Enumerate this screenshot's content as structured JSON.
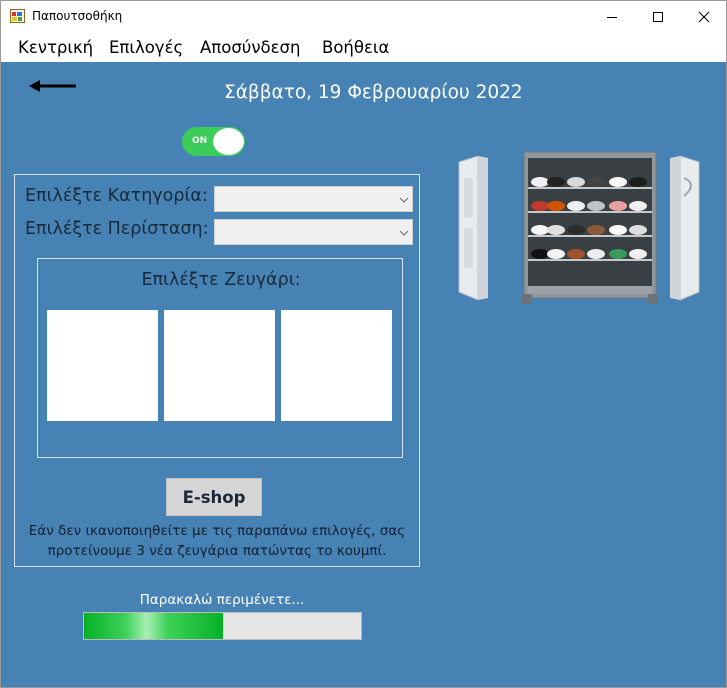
{
  "window": {
    "title": "Παπουτσοθήκη"
  },
  "menu": {
    "items": [
      {
        "label": "Κεντρική"
      },
      {
        "label": "Επιλογές"
      },
      {
        "label": "Αποσύνδεση"
      },
      {
        "label": "Βοήθεια"
      }
    ]
  },
  "header": {
    "date": "Σάββατο, 19 Φεβρουαρίου 2022",
    "back_icon": "left-arrow-icon"
  },
  "toggle": {
    "label": "ON",
    "state": "on",
    "color": "#3bcc5a"
  },
  "form": {
    "category_label": "Επιλέξτε Κατηγορία:",
    "category_value": "",
    "occasion_label": "Επιλέξτε Περίσταση:",
    "occasion_value": ""
  },
  "pairs": {
    "title": "Επιλέξτε Ζευγάρι:"
  },
  "eshop": {
    "button_label": "E-shop",
    "hint_line1": "Εάν δεν ικανοποιηθείτε με τις παραπάνω επιλογές, σας",
    "hint_line2": "προτείνουμε 3 νέα ζευγάρια πατώντας το κουμπί."
  },
  "status": {
    "wait_label": "Παρακαλώ περιμένετε...",
    "progress": 0.5
  },
  "colors": {
    "background": "#4682b4",
    "progress_fill": "#06b025"
  }
}
